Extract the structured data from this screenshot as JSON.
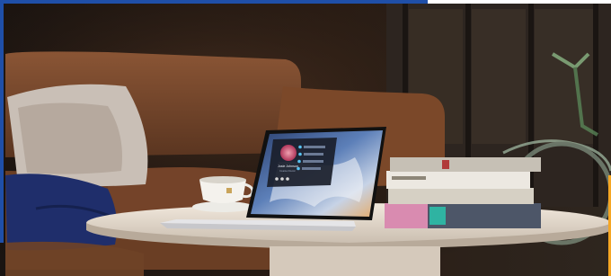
{
  "scene": {
    "subject": "laptop-on-coffee-table",
    "colors": {
      "accent_blue": "#1f4fa8",
      "accent_orange": "#f5a623",
      "sofa": "#7a4a2c",
      "table_top": "#e8ddd0",
      "laptop_silver": "#dcdcde"
    }
  },
  "laptop_screen": {
    "profile_name": "Josie Johnson",
    "profile_subtitle": "Creative Director"
  }
}
